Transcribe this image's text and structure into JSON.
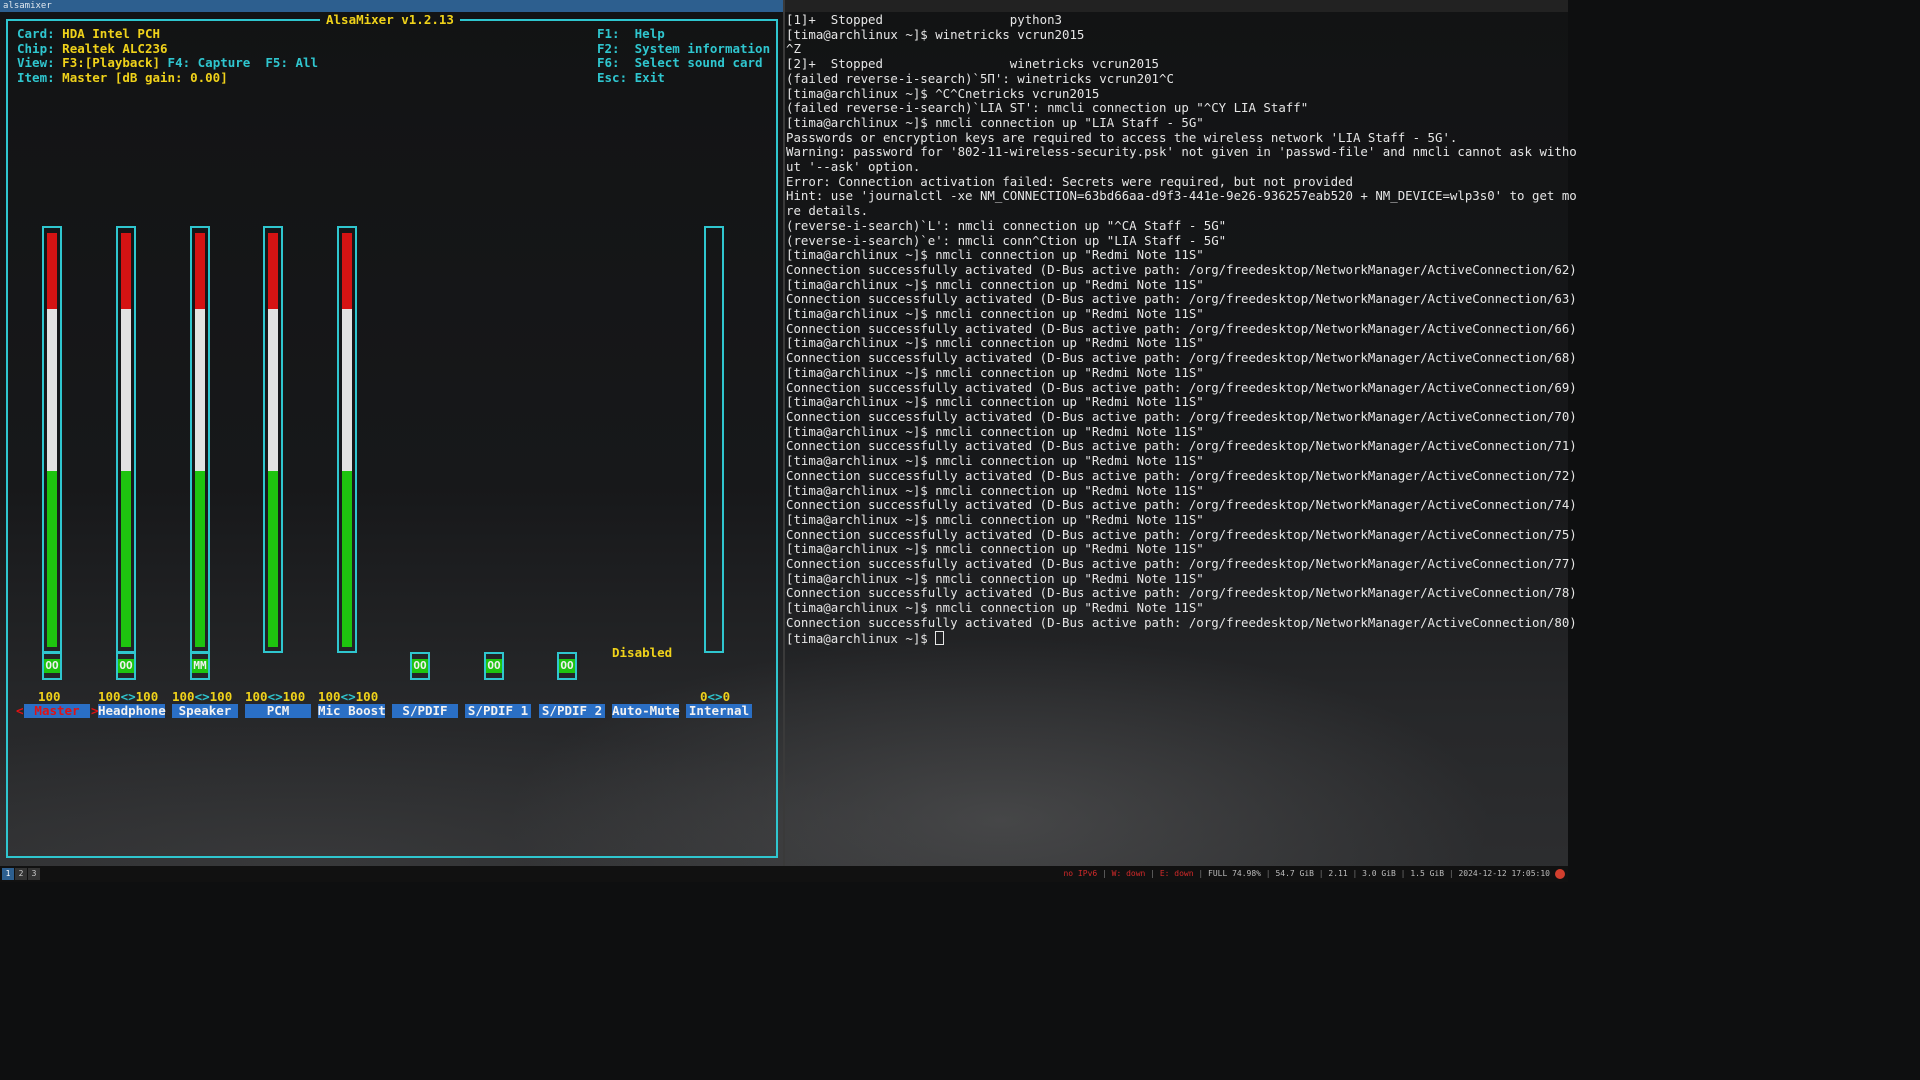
{
  "window": {
    "title": "alsamixer"
  },
  "mixer": {
    "title": "AlsaMixer v1.2.13",
    "card_label": "Card:",
    "card": "HDA Intel PCH",
    "chip_label": "Chip:",
    "chip": "Realtek ALC236",
    "view_label": "View:",
    "view_playback": "F3:[Playback]",
    "view_capture": "F4: Capture",
    "view_all": "F5: All",
    "item_label": "Item:",
    "item": "Master [dB gain: 0.00]",
    "help": [
      {
        "key": "F1:",
        "text": "Help"
      },
      {
        "key": "F2:",
        "text": "System information"
      },
      {
        "key": "F6:",
        "text": "Select sound card"
      },
      {
        "key": "Esc:",
        "text": "Exit"
      }
    ],
    "disabled_text": "Disabled",
    "channels": [
      {
        "name": "Master",
        "volume": "100",
        "level": 100,
        "switch": "OO",
        "selected": true
      },
      {
        "name": "Headphone",
        "volume_l": "100",
        "volume_r": "100",
        "level": 100,
        "switch": "OO"
      },
      {
        "name": "Speaker",
        "volume_l": "100",
        "volume_r": "100",
        "level": 100,
        "switch": "MM"
      },
      {
        "name": "PCM",
        "volume_l": "100",
        "volume_r": "100",
        "level": 100
      },
      {
        "name": "Mic Boost",
        "volume_l": "100",
        "volume_r": "100",
        "level": 100
      },
      {
        "name": "S/PDIF",
        "switch": "OO"
      },
      {
        "name": "S/PDIF 1",
        "switch": "OO"
      },
      {
        "name": "S/PDIF 2",
        "switch": "OO"
      },
      {
        "name": "Auto-Mute",
        "value": "Disabled"
      },
      {
        "name": "Internal",
        "volume_l": "0",
        "volume_r": "0",
        "level": 0
      }
    ],
    "arrow": "<>",
    "sel_left": "<",
    "sel_right": ">"
  },
  "terminal": {
    "lines": [
      "[1]+  Stopped                 python3",
      "[tima@archlinux ~]$ winetricks vcrun2015",
      "^Z",
      "[2]+  Stopped                 winetricks vcrun2015",
      "(failed reverse-i-search)`5П': winetricks vcrun201^C",
      "[tima@archlinux ~]$ ^C^Cnetricks vcrun2015",
      "(failed reverse-i-search)`LIA ST': nmcli connection up \"^CY LIA Staff\"",
      "[tima@archlinux ~]$ nmcli connection up \"LIA Staff - 5G\"",
      "Passwords or encryption keys are required to access the wireless network 'LIA Staff - 5G'.",
      "Warning: password for '802-11-wireless-security.psk' not given in 'passwd-file' and nmcli cannot ask witho",
      "ut '--ask' option.",
      "Error: Connection activation failed: Secrets were required, but not provided",
      "Hint: use 'journalctl -xe NM_CONNECTION=63bd66aa-d9f3-441e-9e26-936257eab520 + NM_DEVICE=wlp3s0' to get mo",
      "re details.",
      "(reverse-i-search)`L': nmcli connection up \"^CA Staff - 5G\"",
      "(reverse-i-search)`e': nmcli conn^Ction up \"LIA Staff - 5G\"",
      "[tima@archlinux ~]$ nmcli connection up \"Redmi Note 11S\"",
      "Connection successfully activated (D-Bus active path: /org/freedesktop/NetworkManager/ActiveConnection/62)",
      "[tima@archlinux ~]$ nmcli connection up \"Redmi Note 11S\"",
      "Connection successfully activated (D-Bus active path: /org/freedesktop/NetworkManager/ActiveConnection/63)",
      "[tima@archlinux ~]$ nmcli connection up \"Redmi Note 11S\"",
      "Connection successfully activated (D-Bus active path: /org/freedesktop/NetworkManager/ActiveConnection/66)",
      "[tima@archlinux ~]$ nmcli connection up \"Redmi Note 11S\"",
      "Connection successfully activated (D-Bus active path: /org/freedesktop/NetworkManager/ActiveConnection/68)",
      "[tima@archlinux ~]$ nmcli connection up \"Redmi Note 11S\"",
      "Connection successfully activated (D-Bus active path: /org/freedesktop/NetworkManager/ActiveConnection/69)",
      "[tima@archlinux ~]$ nmcli connection up \"Redmi Note 11S\"",
      "Connection successfully activated (D-Bus active path: /org/freedesktop/NetworkManager/ActiveConnection/70)",
      "[tima@archlinux ~]$ nmcli connection up \"Redmi Note 11S\"",
      "Connection successfully activated (D-Bus active path: /org/freedesktop/NetworkManager/ActiveConnection/71)",
      "[tima@archlinux ~]$ nmcli connection up \"Redmi Note 11S\"",
      "Connection successfully activated (D-Bus active path: /org/freedesktop/NetworkManager/ActiveConnection/72)",
      "[tima@archlinux ~]$ nmcli connection up \"Redmi Note 11S\"",
      "Connection successfully activated (D-Bus active path: /org/freedesktop/NetworkManager/ActiveConnection/74)",
      "[tima@archlinux ~]$ nmcli connection up \"Redmi Note 11S\"",
      "Connection successfully activated (D-Bus active path: /org/freedesktop/NetworkManager/ActiveConnection/75)",
      "[tima@archlinux ~]$ nmcli connection up \"Redmi Note 11S\"",
      "Connection successfully activated (D-Bus active path: /org/freedesktop/NetworkManager/ActiveConnection/77)",
      "[tima@archlinux ~]$ nmcli connection up \"Redmi Note 11S\"",
      "Connection successfully activated (D-Bus active path: /org/freedesktop/NetworkManager/ActiveConnection/78)",
      "[tima@archlinux ~]$ nmcli connection up \"Redmi Note 11S\"",
      "Connection successfully activated (D-Bus active path: /org/freedesktop/NetworkManager/ActiveConnection/80)"
    ],
    "prompt": "[tima@archlinux ~]$ "
  },
  "statusbar": {
    "workspaces": [
      "1",
      "2",
      "3"
    ],
    "active_workspace": "1",
    "ipv6": "no IPv6",
    "wifi": "W: down",
    "ethernet": "E: down",
    "battery": "FULL 74.98%",
    "disk": "54.7 GiB",
    "load": "2.11",
    "memory": "3.0 GiB",
    "swap": "1.5 GiB",
    "datetime": "2024-12-12 17:05:10"
  },
  "colors": {
    "accent_cyan": "#2fc6cf",
    "value_yellow": "#f0d21a",
    "channel_blue": "#2a6fc5",
    "meter_red": "#d41313",
    "meter_white": "#e2e2e2",
    "meter_green": "#1ec40f"
  }
}
